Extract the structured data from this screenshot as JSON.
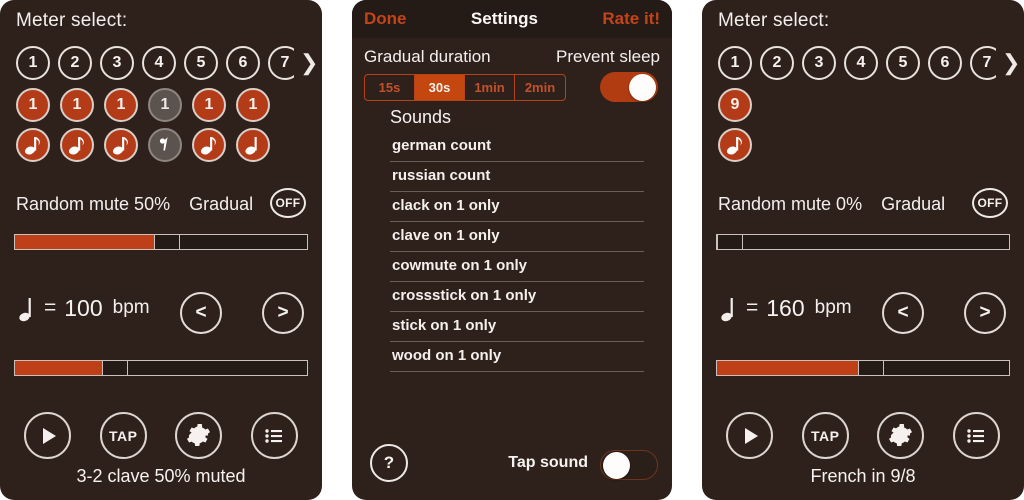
{
  "app": {
    "accent": "#b43b17",
    "background": "#2e211c",
    "page_background": "#ffffff"
  },
  "panels": {
    "left": {
      "meter_label": "Meter select:",
      "meter_numbers": [
        "1",
        "2",
        "3",
        "4",
        "5",
        "6",
        "7"
      ],
      "meter_more_icon": "chevron-right-icon",
      "beats": [
        {
          "label": "1",
          "state": "active"
        },
        {
          "label": "1",
          "state": "active"
        },
        {
          "label": "1",
          "state": "active"
        },
        {
          "label": "1",
          "state": "muted"
        },
        {
          "label": "1",
          "state": "active"
        },
        {
          "label": "1",
          "state": "active"
        }
      ],
      "notes": [
        {
          "icon": "eighth-note-icon",
          "state": "active"
        },
        {
          "icon": "eighth-note-icon",
          "state": "active"
        },
        {
          "icon": "eighth-note-icon",
          "state": "active"
        },
        {
          "icon": "eighth-rest-icon",
          "state": "muted"
        },
        {
          "icon": "eighth-note-icon",
          "state": "active"
        },
        {
          "icon": "quarter-note-icon",
          "state": "active"
        }
      ],
      "random_mute_label": "Random mute 50%",
      "gradual_label": "Gradual",
      "gradual_state": "OFF",
      "mute_slider_percent": 50,
      "tempo_note_icon": "quarter-note-icon",
      "tempo_equals": "=",
      "tempo_value": "100",
      "tempo_unit": "bpm",
      "tempo_slider_percent": 30,
      "step_prev": "<",
      "step_next": ">",
      "toolbar": [
        {
          "name": "play-button",
          "label": "",
          "icon": "play-icon"
        },
        {
          "name": "tap-button",
          "label": "TAP",
          "icon": "tap-icon"
        },
        {
          "name": "settings-button",
          "label": "",
          "icon": "gear-icon"
        },
        {
          "name": "list-button",
          "label": "",
          "icon": "list-icon"
        }
      ],
      "pattern_name": "3-2 clave 50% muted"
    },
    "settings": {
      "done_label": "Done",
      "title": "Settings",
      "rate_label": "Rate it!",
      "gradual_duration_label": "Gradual duration",
      "prevent_sleep_label": "Prevent sleep",
      "prevent_sleep_on": true,
      "durations": [
        {
          "label": "15s",
          "active": false
        },
        {
          "label": "30s",
          "active": true
        },
        {
          "label": "1min",
          "active": false
        },
        {
          "label": "2min",
          "active": false
        }
      ],
      "sounds_title": "Sounds",
      "sounds": [
        "german count",
        "russian count",
        "clack on 1 only",
        "clave on 1 only",
        "cowmute on 1 only",
        "crossstick on 1 only",
        "stick on 1 only",
        "wood on 1 only"
      ],
      "help_label": "?",
      "tap_sound_label": "Tap sound",
      "tap_sound_on": false
    },
    "right": {
      "meter_label": "Meter select:",
      "meter_numbers": [
        "1",
        "2",
        "3",
        "4",
        "5",
        "6",
        "7"
      ],
      "meter_more_icon": "chevron-right-icon",
      "beats": [
        {
          "label": "9",
          "state": "active"
        }
      ],
      "notes": [
        {
          "icon": "eighth-note-icon",
          "state": "active"
        }
      ],
      "random_mute_label": "Random mute 0%",
      "gradual_label": "Gradual",
      "gradual_state": "OFF",
      "mute_slider_percent": 0,
      "tempo_note_icon": "quarter-note-icon",
      "tempo_equals": "=",
      "tempo_value": "160",
      "tempo_unit": "bpm",
      "tempo_slider_percent": 48,
      "step_prev": "<",
      "step_next": ">",
      "toolbar": [
        {
          "name": "play-button",
          "label": "",
          "icon": "play-icon"
        },
        {
          "name": "tap-button",
          "label": "TAP",
          "icon": "tap-icon"
        },
        {
          "name": "settings-button",
          "label": "",
          "icon": "gear-icon"
        },
        {
          "name": "list-button",
          "label": "",
          "icon": "list-icon"
        }
      ],
      "pattern_name": "French in 9/8"
    }
  }
}
